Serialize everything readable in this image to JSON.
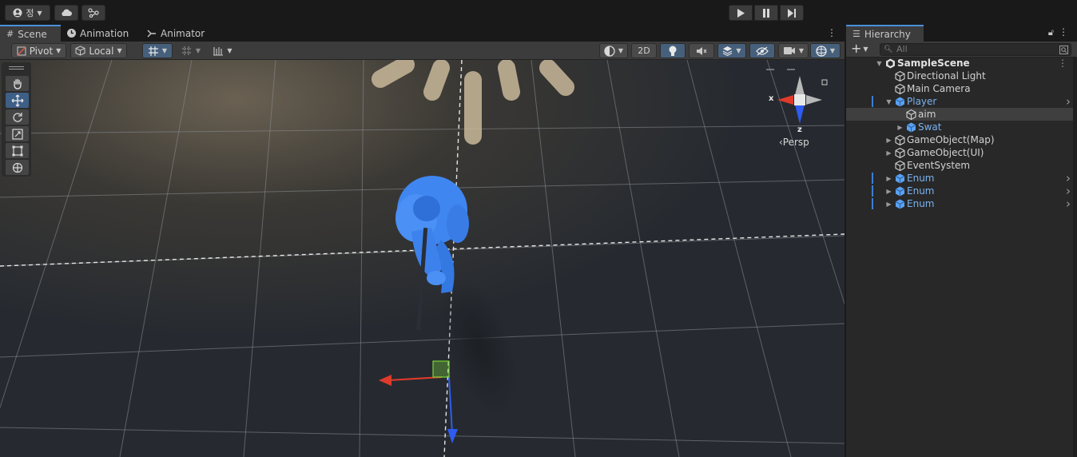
{
  "topbar": {
    "account_label": "정",
    "icons": [
      "account-icon",
      "cloud-icon",
      "collab-icon"
    ],
    "play_controls": [
      "play-icon",
      "pause-icon",
      "step-icon"
    ]
  },
  "scene_tabs": [
    {
      "label": "Scene",
      "icon": "grid-icon"
    },
    {
      "label": "Animation",
      "icon": "clock-icon"
    },
    {
      "label": "Animator",
      "icon": "animator-icon"
    }
  ],
  "scene_toolbar": {
    "pivot_label": "Pivot",
    "local_label": "Local",
    "twod_label": "2D"
  },
  "gizmo": {
    "x_label": "x",
    "z_label": "z",
    "persp_label": "‹Persp"
  },
  "hierarchy": {
    "tab_label": "Hierarchy",
    "search_placeholder": "All",
    "scene_name": "SampleScene",
    "items": [
      {
        "label": "Directional Light",
        "depth": 1,
        "expander": "",
        "prefab": false,
        "selected": false
      },
      {
        "label": "Main Camera",
        "depth": 1,
        "expander": "",
        "prefab": false,
        "selected": false
      },
      {
        "label": "Player",
        "depth": 1,
        "expander": "open",
        "prefab": true,
        "selected": false
      },
      {
        "label": "aim",
        "depth": 2,
        "expander": "",
        "prefab": false,
        "selected": true
      },
      {
        "label": "Swat",
        "depth": 2,
        "expander": "closed",
        "prefab": true,
        "selected": false
      },
      {
        "label": "GameObject(Map)",
        "depth": 1,
        "expander": "closed",
        "prefab": false,
        "selected": false
      },
      {
        "label": "GameObject(UI)",
        "depth": 1,
        "expander": "closed",
        "prefab": false,
        "selected": false
      },
      {
        "label": "EventSystem",
        "depth": 1,
        "expander": "",
        "prefab": false,
        "selected": false
      },
      {
        "label": "Enum",
        "depth": 1,
        "expander": "closed",
        "prefab": true,
        "selected": false
      },
      {
        "label": "Enum",
        "depth": 1,
        "expander": "closed",
        "prefab": true,
        "selected": false
      },
      {
        "label": "Enum",
        "depth": 1,
        "expander": "closed",
        "prefab": true,
        "selected": false
      }
    ]
  },
  "colors": {
    "accent": "#4a90d9",
    "prefab_text": "#79b2f0",
    "character": "#3f86f0",
    "axis_x": "#e03a2a",
    "axis_y": "#7bd33a",
    "axis_z": "#2e5cf0"
  }
}
